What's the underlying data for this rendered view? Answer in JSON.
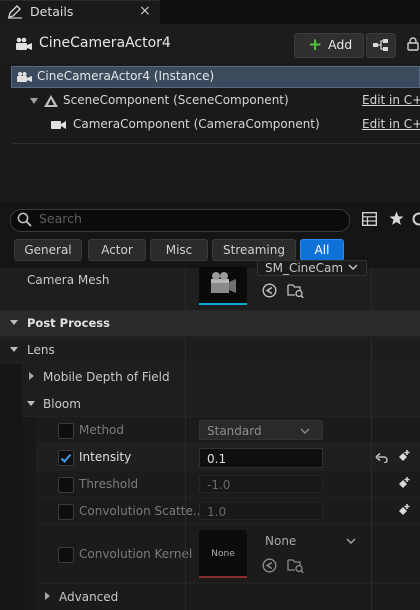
{
  "tab": {
    "title": "Details",
    "close": "×"
  },
  "header": {
    "actor_name": "CineCameraActor4",
    "add_label": "Add"
  },
  "tree": {
    "instance_label": "CineCameraActor4 (Instance)",
    "scene_component": "SceneComponent (SceneComponent)",
    "camera_component": "CameraComponent (CameraComponent)",
    "edit_label": "Edit in C++"
  },
  "search": {
    "placeholder": "Search"
  },
  "categories": [
    "General",
    "Actor",
    "Misc",
    "Streaming",
    "All"
  ],
  "props": {
    "camera_mesh_label": "Camera Mesh",
    "camera_mesh_value": "SM_CineCam",
    "post_process": "Post Process",
    "lens": "Lens",
    "mobile_dof": "Mobile Depth of Field",
    "bloom": "Bloom",
    "method_label": "Method",
    "method_value": "Standard",
    "intensity_label": "Intensity",
    "intensity_value": "0.1",
    "threshold_label": "Threshold",
    "threshold_value": "-1.0",
    "conv_scatter_label": "Convolution Scatte...",
    "conv_scatter_value": "1.0",
    "conv_kernel_label": "Convolution Kernel",
    "conv_kernel_thumb": "None",
    "conv_kernel_value": "None",
    "advanced": "Advanced"
  },
  "colors": {
    "accent": "#0f72d8",
    "add_plus": "#4fc233",
    "selected_row": "#3b4a5d"
  }
}
